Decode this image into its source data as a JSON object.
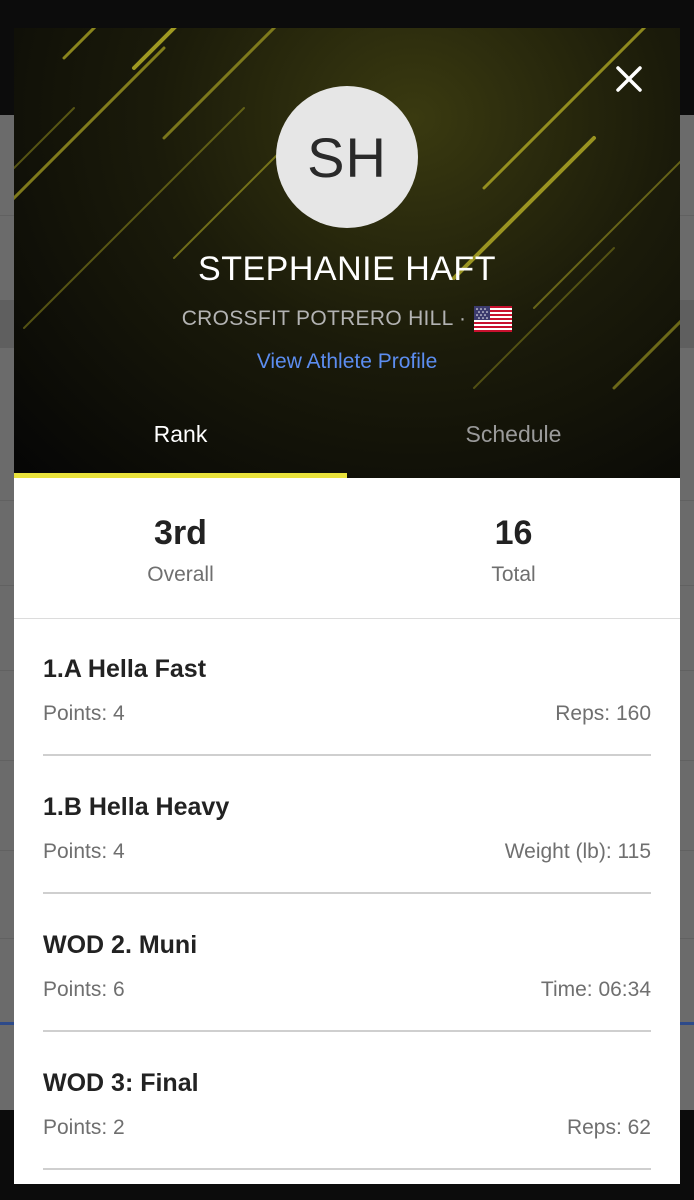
{
  "athlete": {
    "initials": "SH",
    "name": "STEPHANIE HAFT",
    "affiliation": "CROSSFIT POTRERO HILL ·",
    "flag_icon": "us-flag-icon",
    "profile_link": "View Athlete Profile"
  },
  "tabs": [
    {
      "label": "Rank",
      "active": true
    },
    {
      "label": "Schedule",
      "active": false
    }
  ],
  "summary": {
    "overall_value": "3rd",
    "overall_label": "Overall",
    "total_value": "16",
    "total_label": "Total"
  },
  "events": [
    {
      "title": "1.A Hella Fast",
      "points": "Points: 4",
      "score": "Reps: 160"
    },
    {
      "title": "1.B Hella Heavy",
      "points": "Points: 4",
      "score": "Weight (lb): 115"
    },
    {
      "title": "WOD 2. Muni",
      "points": "Points: 6",
      "score": "Time: 06:34"
    },
    {
      "title": "WOD 3: Final",
      "points": "Points: 2",
      "score": "Reps: 62"
    }
  ],
  "colors": {
    "accent": "#e9e23c",
    "link": "#5c8df0"
  }
}
